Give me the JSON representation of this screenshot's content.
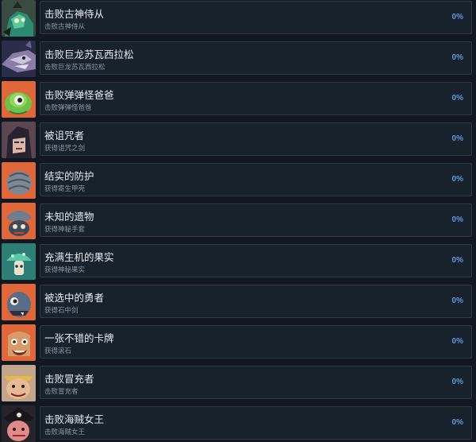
{
  "achievements": [
    {
      "title": "击败古神侍从",
      "desc": "击败古神侍从",
      "percent": "0%",
      "icon": "servant-icon",
      "bg": "#3a4b44"
    },
    {
      "title": "击败巨龙苏瓦西拉松",
      "desc": "击败巨龙苏瓦西拉松",
      "percent": "0%",
      "icon": "dragon-icon",
      "bg": "#2a2d4a"
    },
    {
      "title": "击败弹弹怪爸爸",
      "desc": "击败弹弹怪爸爸",
      "percent": "0%",
      "icon": "green-blob-icon",
      "bg": "#e0673a"
    },
    {
      "title": "被诅咒者",
      "desc": "获得诅咒之剑",
      "percent": "0%",
      "icon": "cursed-icon",
      "bg": "#5b4652"
    },
    {
      "title": "结实的防护",
      "desc": "获得寄生甲壳",
      "percent": "0%",
      "icon": "shell-icon",
      "bg": "#e0673a"
    },
    {
      "title": "未知的遗物",
      "desc": "获得神秘手套",
      "percent": "0%",
      "icon": "relic-icon",
      "bg": "#e0673a"
    },
    {
      "title": "充满生机的果实",
      "desc": "获得神秘果实",
      "percent": "0%",
      "icon": "fruit-icon",
      "bg": "#2d7f75"
    },
    {
      "title": "被选中的勇者",
      "desc": "获得石中剑",
      "percent": "0%",
      "icon": "hero-icon",
      "bg": "#e0673a"
    },
    {
      "title": "一张不错的卡牌",
      "desc": "获得滚石",
      "percent": "0%",
      "icon": "card-icon",
      "bg": "#e0673a"
    },
    {
      "title": "击败冒充者",
      "desc": "击败冒充者",
      "percent": "0%",
      "icon": "impostor-icon",
      "bg": "#c2a68b"
    },
    {
      "title": "击败海贼女王",
      "desc": "击败海贼女王",
      "percent": "0%",
      "icon": "pirate-queen-icon",
      "bg": "#27232a"
    }
  ]
}
